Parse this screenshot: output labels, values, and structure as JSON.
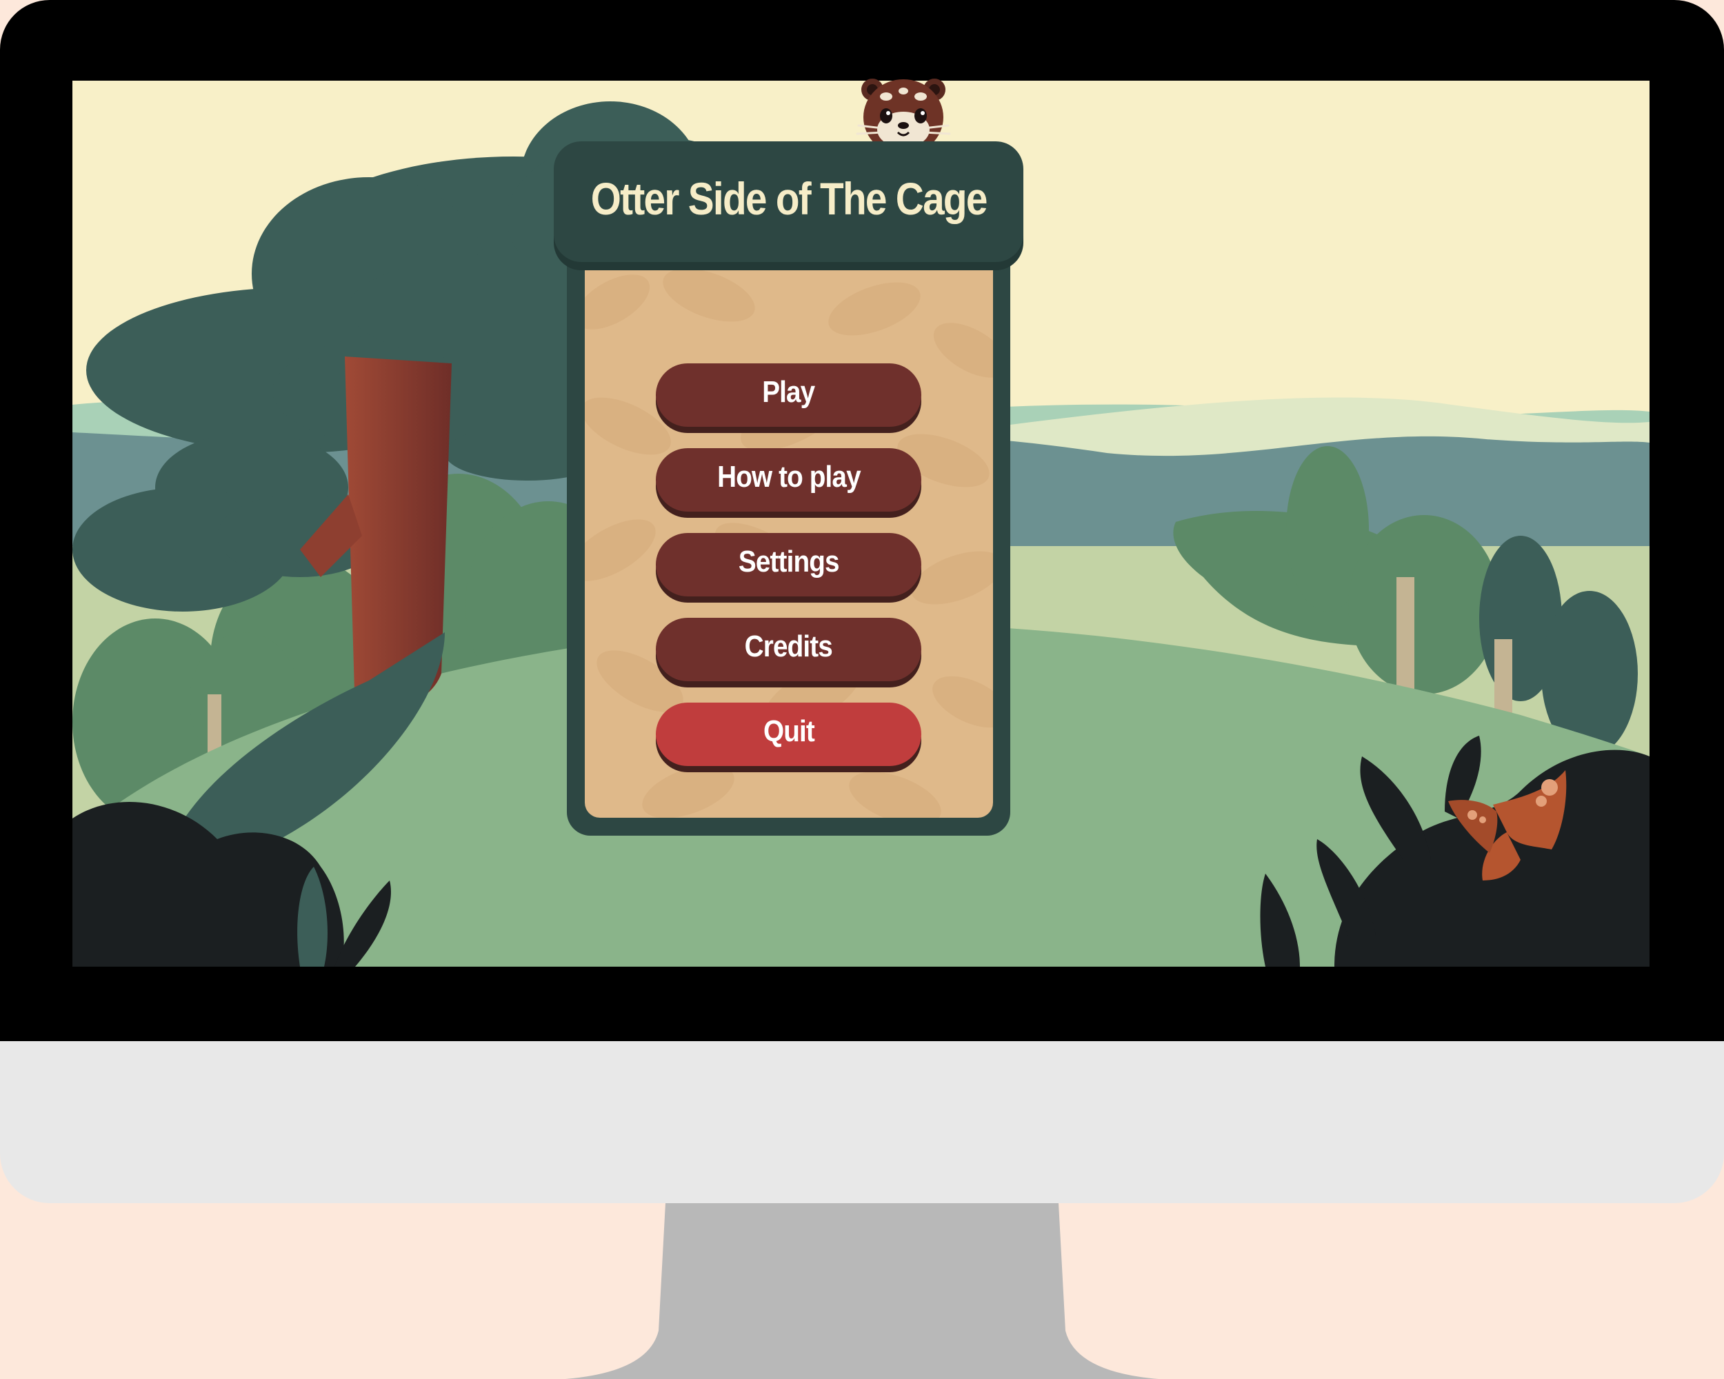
{
  "game": {
    "title": "Otter Side of The Cage"
  },
  "menu": {
    "items": [
      {
        "label": "Play"
      },
      {
        "label": "How to play"
      },
      {
        "label": "Settings"
      },
      {
        "label": "Credits"
      },
      {
        "label": "Quit"
      }
    ]
  },
  "colors": {
    "sky": "#f8f0c8",
    "panel": "#2d4743",
    "panel_inner": "#dfb98a",
    "button": "#6f302c",
    "quit_button": "#c03d3d",
    "title_text": "#f6edc8"
  },
  "icons": {
    "mascot": "otter-icon"
  }
}
